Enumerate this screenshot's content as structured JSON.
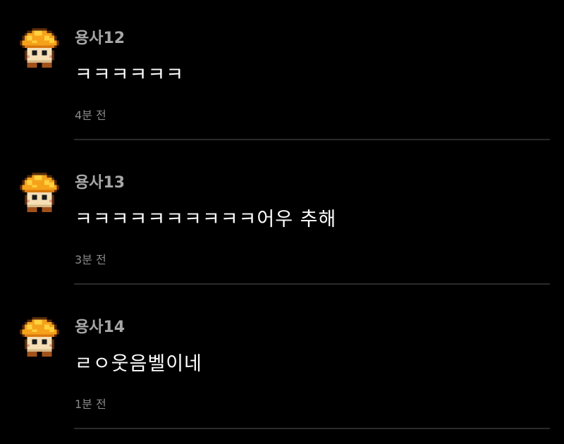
{
  "colors": {
    "background": "#000000",
    "username": "#a7a7a7",
    "message": "#ffffff",
    "timestamp": "#8a8a8a",
    "divider": "#2a2a2a",
    "avatar_cap": "#f5a21a"
  },
  "comments": [
    {
      "avatar_icon": "orange-mushroom-icon",
      "username": "용사12",
      "message": "ㅋㅋㅋㅋㅋㅋ",
      "time": "4분 전"
    },
    {
      "avatar_icon": "orange-mushroom-icon",
      "username": "용사13",
      "message": "ㅋㅋㅋㅋㅋㅋㅋㅋㅋㅋ어우 추해",
      "time": "3분 전"
    },
    {
      "avatar_icon": "orange-mushroom-icon",
      "username": "용사14",
      "message": "ㄹㅇ웃음벨이네",
      "time": "1분 전"
    }
  ]
}
